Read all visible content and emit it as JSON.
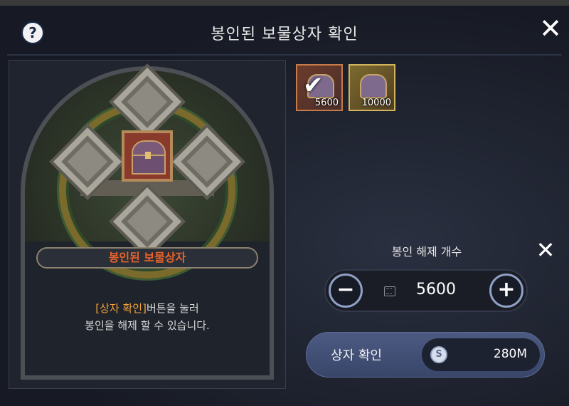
{
  "window": {
    "title": "봉인된 보물상자 확인",
    "help_glyph": "?",
    "close_glyph": "✕"
  },
  "left_panel": {
    "item_name": "봉인된 보물상자",
    "desc_highlight": "[상자 확인]",
    "desc_line1_rest": "버튼을 눌러",
    "desc_line2": "봉인을 해제 할 수 있습니다.",
    "accent_color": "#e8622a"
  },
  "inventory_slots": [
    {
      "quantity": "5600",
      "selected": true,
      "check_glyph": "✔"
    },
    {
      "quantity": "10000",
      "selected": false
    }
  ],
  "unseal": {
    "title": "봉인 해제 개수",
    "close_glyph": "✕",
    "minus_glyph": "−",
    "plus_glyph": "+",
    "quantity": "5600",
    "confirm_label": "상자 확인",
    "coin_glyph": "S",
    "cost": "280M"
  }
}
